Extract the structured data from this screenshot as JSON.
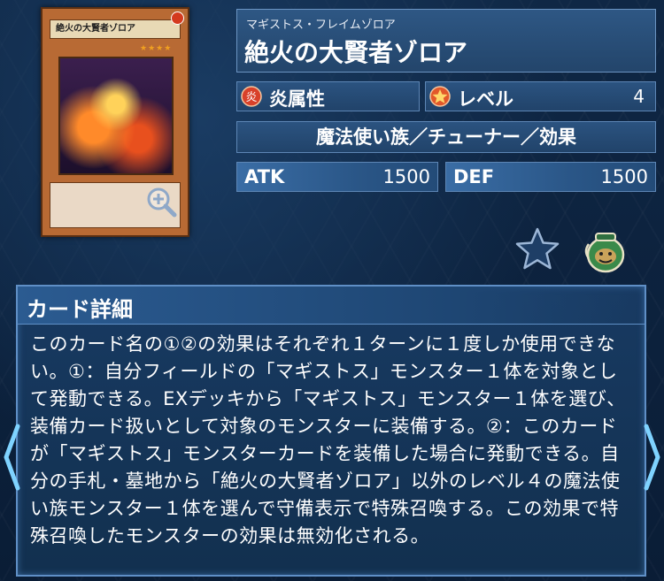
{
  "card": {
    "ruby": "マギストス・フレイムゾロア",
    "name": "絶火の大賢者ゾロア",
    "thumb_name": "絶火の大賢者ゾロア",
    "thumb_stars": "★★★★"
  },
  "attribute": {
    "label": "炎属性",
    "icon": "fire-attribute-icon",
    "color": "#d8412a"
  },
  "level": {
    "label": "レベル",
    "value": "4",
    "icon": "level-star-icon",
    "color": "#e2582a"
  },
  "type_line": "魔法使い族／チューナー／効果",
  "atk": {
    "label": "ATK",
    "value": "1500"
  },
  "def": {
    "label": "DEF",
    "value": "1500"
  },
  "detail": {
    "title": "カード詳細",
    "text": "このカード名の①②の効果はそれぞれ１ターンに１度しか使用できない。①：自分フィールドの「マギストス」モンスター１体を対象として発動できる。EXデッキから「マギストス」モンスター１体を選び、装備カード扱いとして対象のモンスターに装備する。②：このカードが「マギストス」モンスターカードを装備した場合に発動できる。自分の手札・墓地から「絶火の大賢者ゾロア」以外のレベル４の魔法使い族モンスター１体を選んで守備表示で特殊召喚する。この効果で特殊召喚したモンスターの効果は無効化される。"
  },
  "icons": {
    "zoom": "zoom-in-icon",
    "favorite": "star-icon",
    "jar": "pot-of-greed-icon",
    "prev": "chevron-left-icon",
    "next": "chevron-right-icon"
  },
  "colors": {
    "accent": "#5f8fc6",
    "panel": "#23456b"
  }
}
